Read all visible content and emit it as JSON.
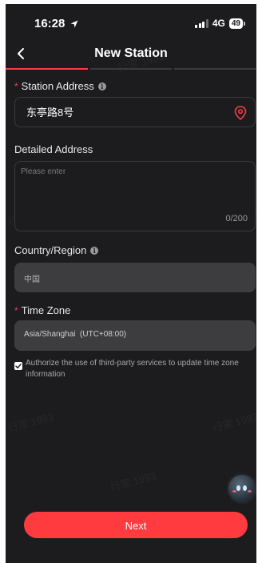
{
  "status_bar": {
    "time": "16:28",
    "network": "4G",
    "battery": "49"
  },
  "header": {
    "title": "New Station",
    "progress_steps_total": 3,
    "progress_step_current": 1
  },
  "form": {
    "station_address": {
      "label": "Station Address",
      "required": true,
      "value": "东亭路8号"
    },
    "detailed_address": {
      "label": "Detailed Address",
      "placeholder": "Please enter",
      "value": "",
      "counter": "0/200"
    },
    "country_region": {
      "label": "Country/Region",
      "value": "中国"
    },
    "time_zone": {
      "label": "Time Zone",
      "required": true,
      "value": "Asia/Shanghai  (UTC+08:00)"
    },
    "authorize": {
      "checked": true,
      "text": "Authorize the use of third-party services to update time zone information"
    }
  },
  "watermark": "行家 1993",
  "actions": {
    "next_label": "Next"
  },
  "colors": {
    "accent": "#ff3b3f",
    "background": "#1c1c1e",
    "field_filled": "#3d3d3f"
  }
}
